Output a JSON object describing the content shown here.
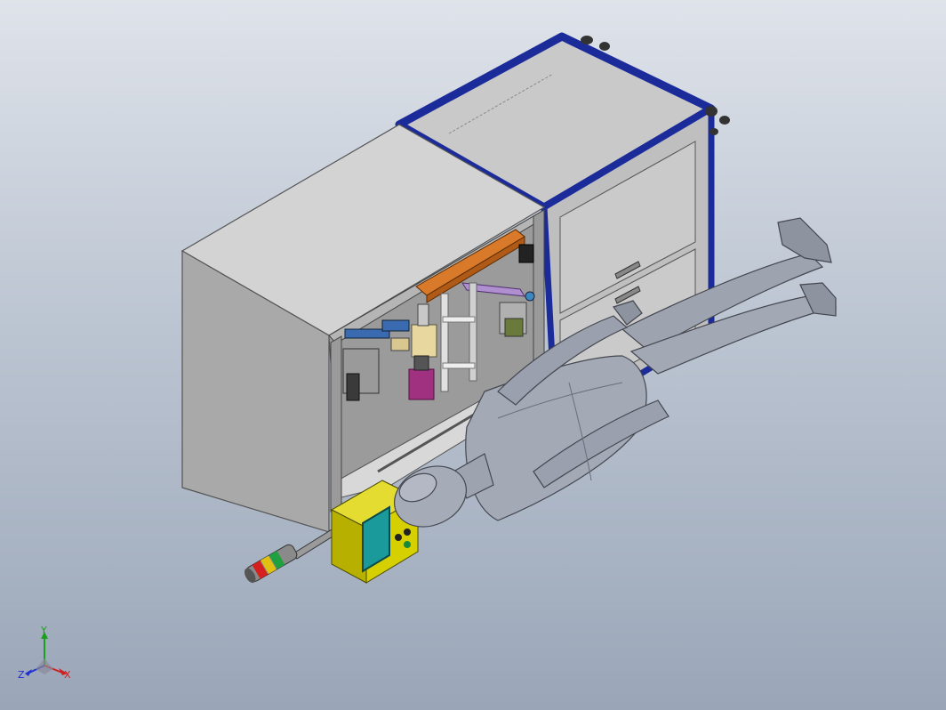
{
  "triad": {
    "x_label": "X",
    "y_label": "Y",
    "z_label": "Z"
  },
  "colors": {
    "background_top": "#dfe3ea",
    "background_bottom": "#9aa6b8",
    "cabinet_panel": "#c8c8c8",
    "frame_blue": "#1b2b9a",
    "control_box": "#d6d000",
    "screen": "#1a9a9a",
    "mannequin": "#9ea3b0",
    "orange_beam": "#d87a2a",
    "magenta_part": "#a03080",
    "lavender_arm": "#b08fd0"
  }
}
